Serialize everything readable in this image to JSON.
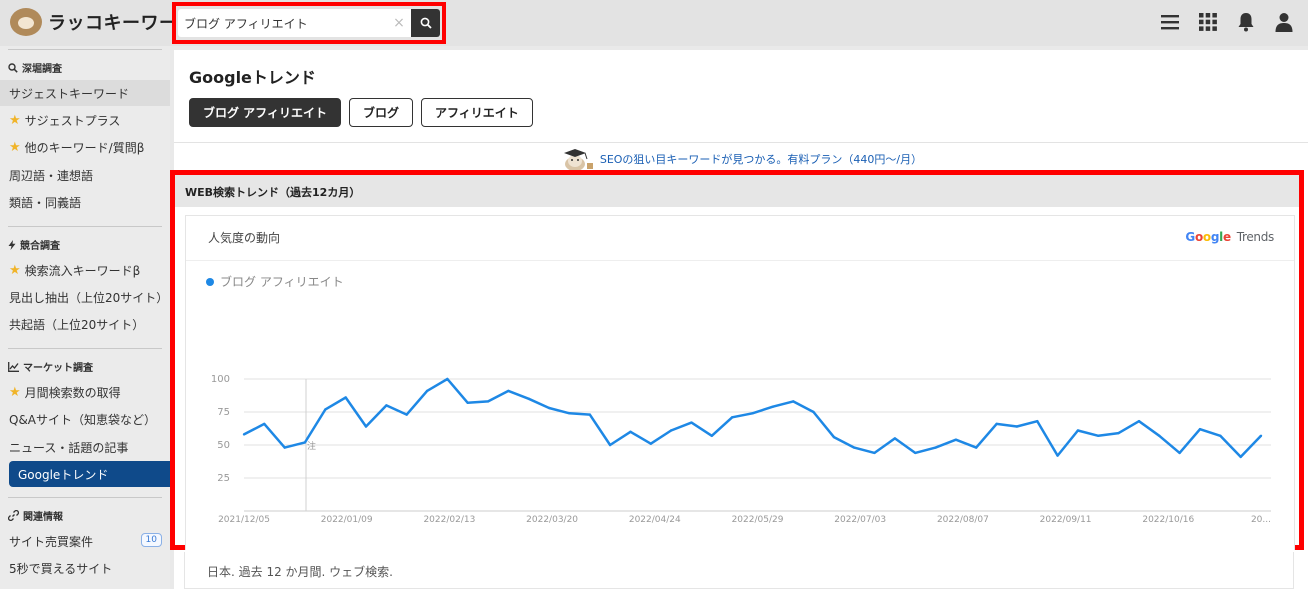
{
  "app": {
    "name": "ラッコキーワード"
  },
  "search": {
    "value": "ブログ アフィリエイト",
    "clear_icon": "×"
  },
  "header": {
    "icons": [
      "menu-icon",
      "apps-grid-icon",
      "bell-icon",
      "user-icon"
    ]
  },
  "sidebar": {
    "sections": [
      {
        "title": "深堀調査",
        "icon": "magnify-icon"
      },
      {
        "title": "競合調査",
        "icon": "bolt-icon"
      },
      {
        "title": "マーケット調査",
        "icon": "chart-line-icon"
      },
      {
        "title": "関連情報",
        "icon": "link-icon"
      }
    ],
    "items": [
      {
        "label": "サジェストキーワード",
        "star": false
      },
      {
        "label": "サジェストプラス",
        "star": true
      },
      {
        "label": "他のキーワード/質問β",
        "star": true
      },
      {
        "label": "周辺語・連想語",
        "star": false
      },
      {
        "label": "類語・同義語",
        "star": false
      },
      {
        "label": "検索流入キーワードβ",
        "star": true
      },
      {
        "label": "見出し抽出（上位20サイト）",
        "star": false
      },
      {
        "label": "共起語（上位20サイト）",
        "star": false
      },
      {
        "label": "月間検索数の取得",
        "star": true
      },
      {
        "label": "Q&Aサイト（知恵袋など）",
        "star": false
      },
      {
        "label": "ニュース・話題の記事",
        "star": false
      },
      {
        "label": "Googleトレンド",
        "star": false
      },
      {
        "label": "サイト売買案件",
        "star": false,
        "badge": "10"
      },
      {
        "label": "5秒で買えるサイト",
        "star": false
      }
    ],
    "active_item": "Googleトレンド"
  },
  "main": {
    "title": "Googleトレンド",
    "tabs": [
      {
        "label": "ブログ アフィリエイト",
        "active": true
      },
      {
        "label": "ブログ",
        "active": false
      },
      {
        "label": "アフィリエイト",
        "active": false
      }
    ],
    "promo": "SEOの狙い目キーワードが見つかる。有料プラン（440円〜/月）"
  },
  "trend": {
    "heading": "WEB検索トレンド（過去12カ月）",
    "card_title": "人気度の動向",
    "brand": {
      "google": "Google",
      "trends": "Trends"
    },
    "footer": "日本. 過去 12 か月間. ウェブ検索.",
    "note_marker": "注"
  },
  "chart_data": {
    "type": "line",
    "series": [
      {
        "name": "ブログ アフィリエイト",
        "color": "#1e88e5",
        "values": [
          58,
          66,
          48,
          52,
          77,
          86,
          64,
          80,
          73,
          91,
          100,
          82,
          83,
          91,
          85,
          78,
          74,
          73,
          50,
          60,
          51,
          61,
          67,
          57,
          71,
          74,
          79,
          83,
          75,
          56,
          48,
          44,
          55,
          44,
          48,
          54,
          48,
          66,
          64,
          68,
          42,
          61,
          57,
          59,
          68,
          57,
          44,
          62,
          57,
          41,
          57
        ]
      }
    ],
    "x_tick_labels": [
      "2021/12/05",
      "2022/01/09",
      "2022/02/13",
      "2022/03/20",
      "2022/04/24",
      "2022/05/29",
      "2022/07/03",
      "2022/08/07",
      "2022/09/11",
      "2022/10/16",
      "20..."
    ],
    "y_ticks": [
      25,
      50,
      75,
      100
    ],
    "ylim": [
      0,
      100
    ],
    "grid": true,
    "legend": "top-left"
  }
}
